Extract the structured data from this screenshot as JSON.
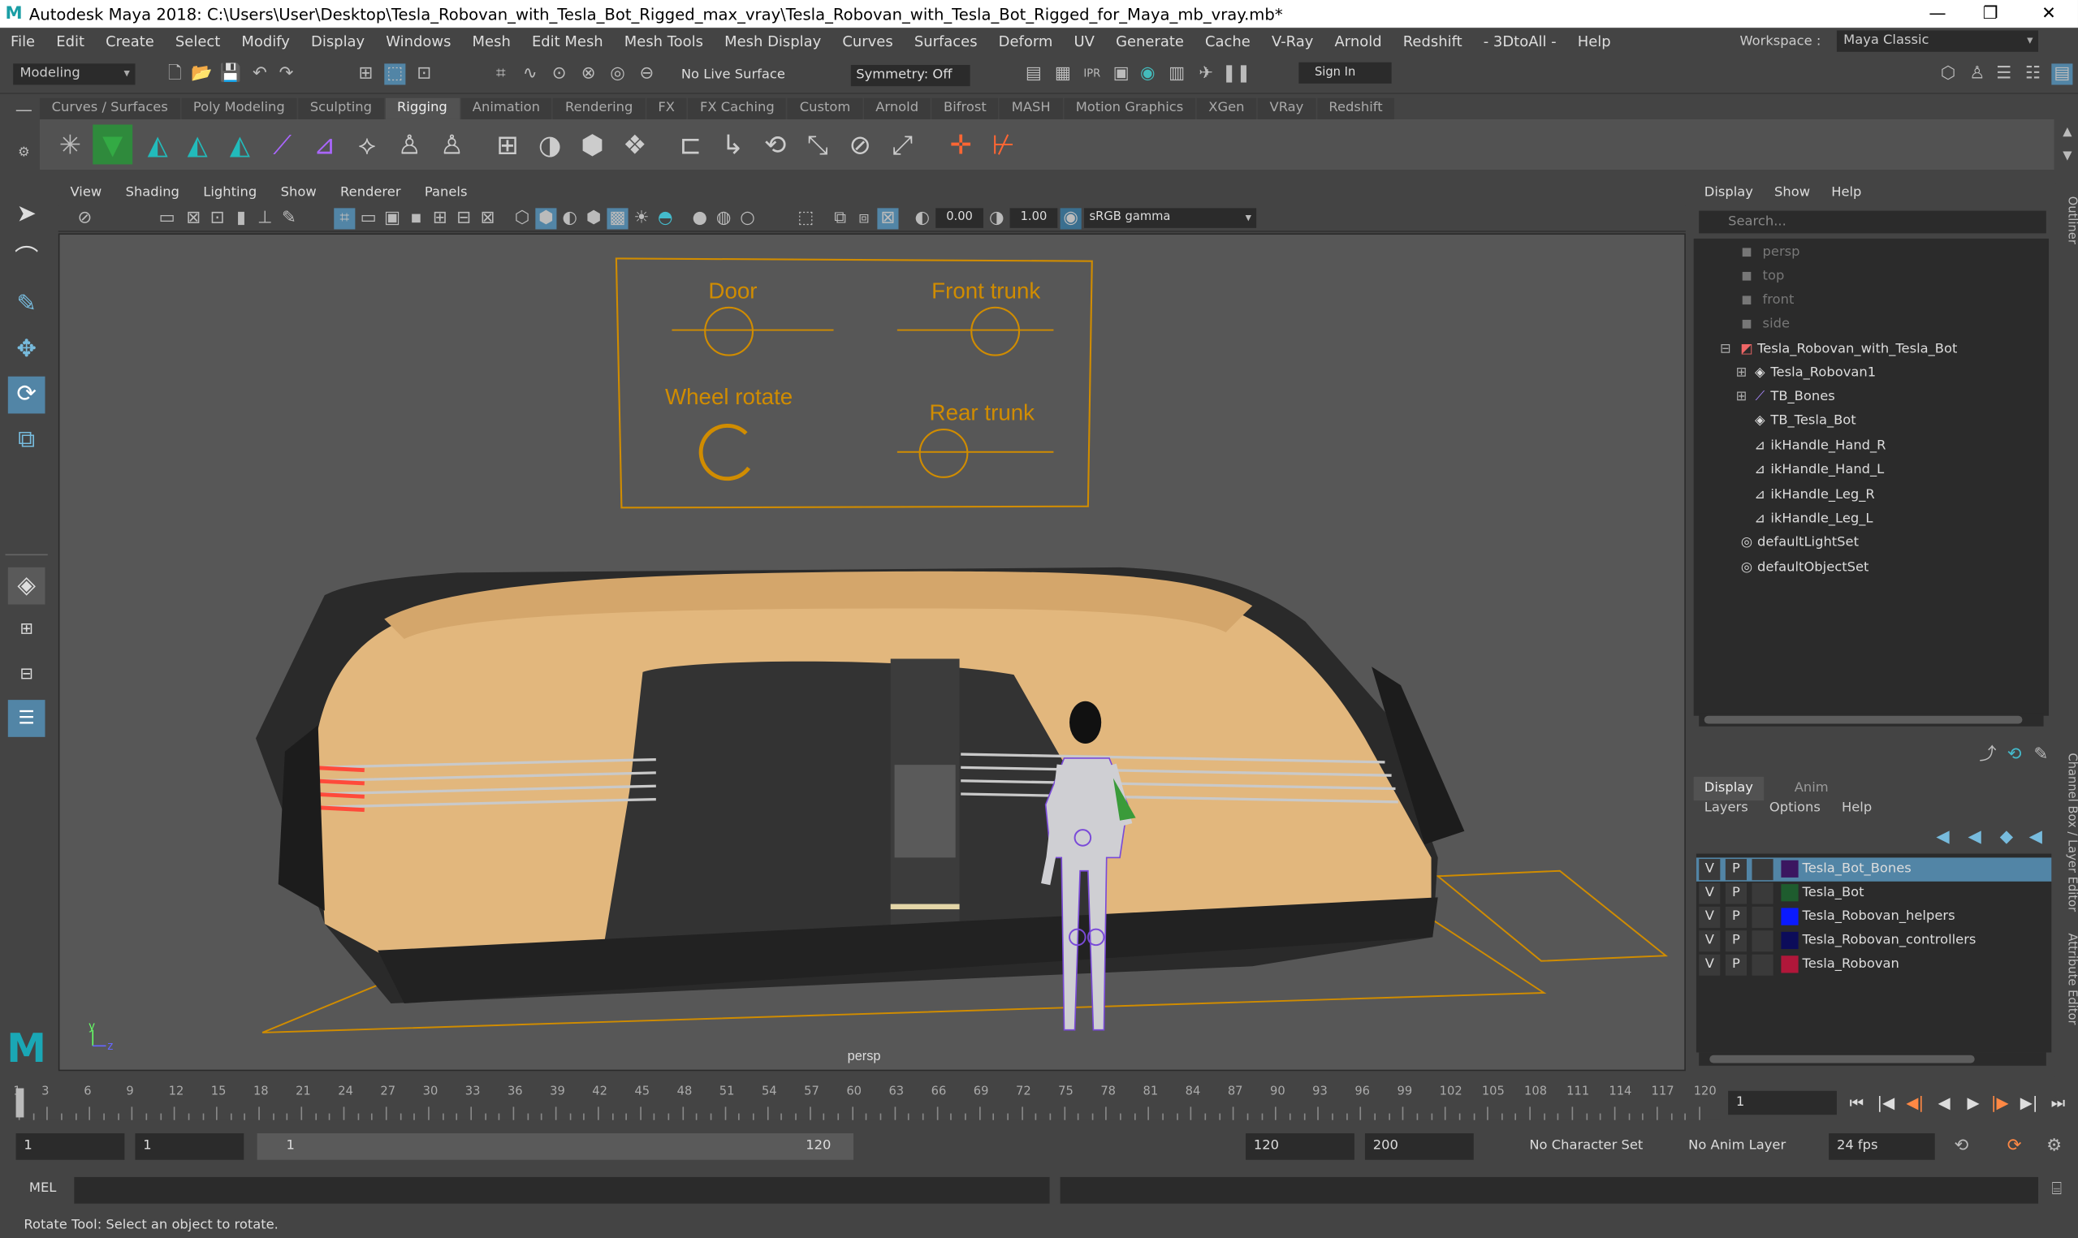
{
  "window": {
    "title": "Autodesk Maya 2018: C:\\Users\\User\\Desktop\\Tesla_Robovan_with_Tesla_Bot_Rigged_max_vray\\Tesla_Robovan_with_Tesla_Bot_Rigged_for_Maya_mb_vray.mb*",
    "minimize": "—",
    "restore": "❐",
    "close": "✕"
  },
  "menu": [
    "File",
    "Edit",
    "Create",
    "Select",
    "Modify",
    "Display",
    "Windows",
    "Mesh",
    "Edit Mesh",
    "Mesh Tools",
    "Mesh Display",
    "Curves",
    "Surfaces",
    "Deform",
    "UV",
    "Generate",
    "Cache",
    "V-Ray",
    "Arnold",
    "Redshift",
    "- 3DtoAll -",
    "Help"
  ],
  "workspace": {
    "label": "Workspace :",
    "value": "Maya Classic"
  },
  "status": {
    "mode": "Modeling",
    "live_surface": "No Live Surface",
    "symmetry": "Symmetry: Off",
    "sign_in": "Sign In"
  },
  "shelf_tabs": [
    "Curves / Surfaces",
    "Poly Modeling",
    "Sculpting",
    "Rigging",
    "Animation",
    "Rendering",
    "FX",
    "FX Caching",
    "Custom",
    "Arnold",
    "Bifrost",
    "MASH",
    "Motion Graphics",
    "XGen",
    "VRay",
    "Redshift"
  ],
  "active_shelf": "Rigging",
  "viewport": {
    "menu": [
      "View",
      "Shading",
      "Lighting",
      "Show",
      "Renderer",
      "Panels"
    ],
    "exposure": "0.00",
    "gamma": "1.00",
    "color_space": "sRGB gamma",
    "camera_label": "persp",
    "controls": {
      "door": "Door",
      "front_trunk": "Front trunk",
      "wheel_rotate": "Wheel rotate",
      "rear_trunk": "Rear trunk"
    },
    "axis": {
      "y": "y",
      "z": "z"
    }
  },
  "outliner": {
    "menu": [
      "Display",
      "Show",
      "Help"
    ],
    "search_placeholder": "Search...",
    "items": [
      {
        "label": "persp",
        "dim": true
      },
      {
        "label": "top",
        "dim": true
      },
      {
        "label": "front",
        "dim": true
      },
      {
        "label": "side",
        "dim": true
      },
      {
        "label": "Tesla_Robovan_with_Tesla_Bot"
      },
      {
        "label": "Tesla_Robovan1"
      },
      {
        "label": "TB_Bones"
      },
      {
        "label": "TB_Tesla_Bot"
      },
      {
        "label": "ikHandle_Hand_R"
      },
      {
        "label": "ikHandle_Hand_L"
      },
      {
        "label": "ikHandle_Leg_R"
      },
      {
        "label": "ikHandle_Leg_L"
      },
      {
        "label": "defaultLightSet"
      },
      {
        "label": "defaultObjectSet"
      }
    ]
  },
  "layer_editor": {
    "tabs": [
      "Display",
      "Anim"
    ],
    "menu": [
      "Layers",
      "Options",
      "Help"
    ],
    "layers": [
      {
        "v": "V",
        "p": "P",
        "name": "Tesla_Bot_Bones",
        "color": "#3b1660",
        "selected": true
      },
      {
        "v": "V",
        "p": "P",
        "name": "Tesla_Bot",
        "color": "#1e5c2e"
      },
      {
        "v": "V",
        "p": "P",
        "name": "Tesla_Robovan_helpers",
        "color": "#0a1aff"
      },
      {
        "v": "V",
        "p": "P",
        "name": "Tesla_Robovan_controllers",
        "color": "#0c0c5a"
      },
      {
        "v": "V",
        "p": "P",
        "name": "Tesla_Robovan",
        "color": "#b0173a"
      }
    ]
  },
  "side_tabs": [
    "Outliner",
    "Channel Box / Layer Editor",
    "Attribute Editor"
  ],
  "timeline": {
    "ticks": [
      "1",
      "3",
      "6",
      "9",
      "12",
      "15",
      "18",
      "21",
      "24",
      "27",
      "30",
      "33",
      "36",
      "39",
      "42",
      "45",
      "48",
      "51",
      "54",
      "57",
      "60",
      "63",
      "66",
      "69",
      "72",
      "75",
      "78",
      "81",
      "84",
      "87",
      "90",
      "93",
      "96",
      "99",
      "102",
      "105",
      "108",
      "111",
      "114",
      "117",
      "120"
    ],
    "current_frame": "1"
  },
  "range": {
    "start": "1",
    "playback_start": "1",
    "slider_start": "1",
    "slider_end": "120",
    "playback_end": "120",
    "end": "200",
    "character_set": "No Character Set",
    "anim_layer": "No Anim Layer",
    "fps": "24 fps"
  },
  "command": {
    "label": "MEL"
  },
  "help_line": "Rotate Tool: Select an object to rotate."
}
